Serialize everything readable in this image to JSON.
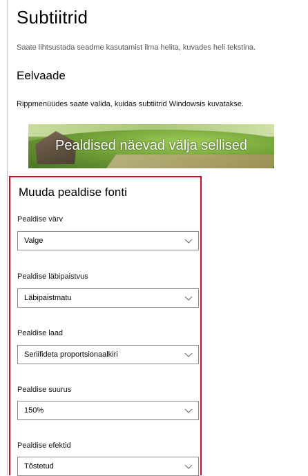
{
  "page": {
    "title": "Subtiitrid",
    "description": "Saate lihtsustada seadme kasutamist ilma helita, kuvades heli tekstina.",
    "preview_heading": "Eelvaade",
    "preview_info": "Rippmenüüdes saate valida, kuidas subtiitrid Windowsis kuvatakse.",
    "preview_caption": "Pealdised näevad välja sellised"
  },
  "font_section": {
    "title": "Muuda pealdise fonti",
    "fields": [
      {
        "label": "Pealdise värv",
        "value": "Valge"
      },
      {
        "label": "Pealdise läbipaistvus",
        "value": "Läbipaistmatu"
      },
      {
        "label": "Pealdise laad",
        "value": "Seriifideta proportsionaalkiri"
      },
      {
        "label": "Pealdise suurus",
        "value": "150%"
      },
      {
        "label": "Pealdise efektid",
        "value": "Tõstetud"
      }
    ]
  },
  "colors": {
    "highlight_border": "#e0001a",
    "dropdown_border": "#8a8a8a"
  },
  "icons": {
    "dropdown": "chevron-down-icon"
  }
}
